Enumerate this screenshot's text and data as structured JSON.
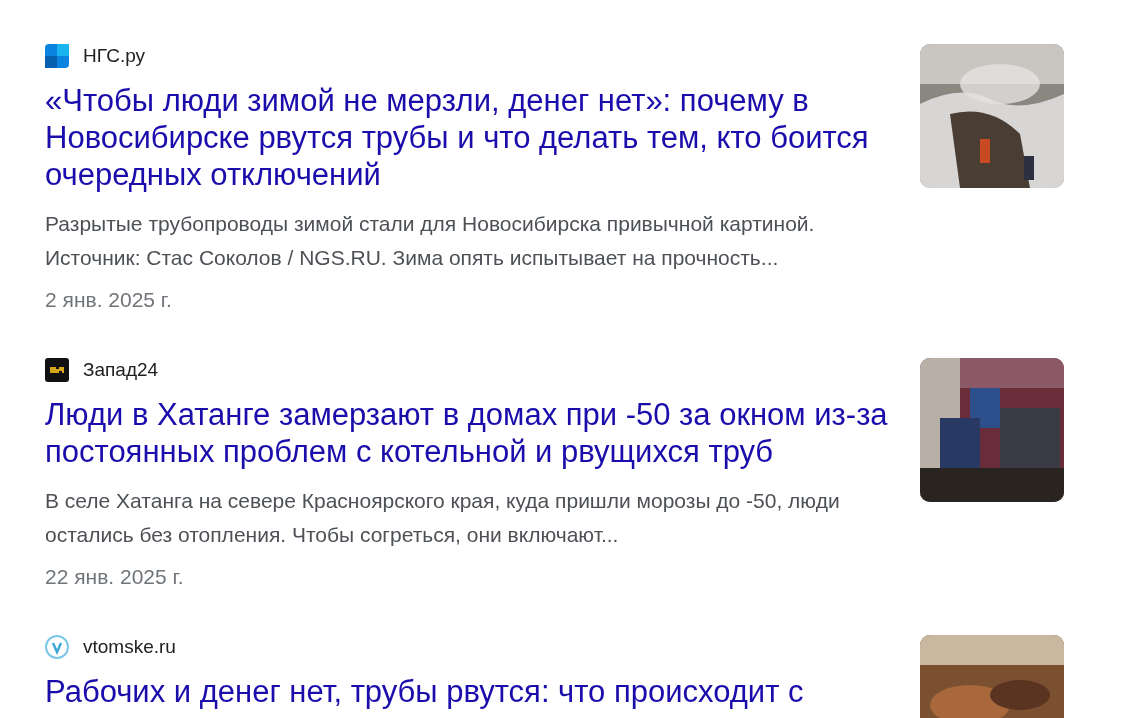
{
  "results": [
    {
      "source": "НГС.ру",
      "title": "«Чтобы люди зимой не мерзли, денег нет»: почему в Новосибирске рвутся трубы и что делать тем, кто боится очередных отключений",
      "snippet": "Разрытые трубопроводы зимой стали для Новосибирска привычной картиной. Источник: Стас Соколов / NGS.RU. Зима опять испытывает на прочность...",
      "date": "2 янв. 2025 г."
    },
    {
      "source": "Запад24",
      "title": "Люди в Хатанге замерзают в домах при -50 за окном из-за постоянных проблем с котельной и рвущихся труб",
      "snippet": "В селе Хатанга на севере Красноярского края, куда пришли морозы до -50, люди остались без отопления. Чтобы согреться, они включают...",
      "date": "22 янв. 2025 г."
    },
    {
      "source": "vtomske.ru",
      "title": "Рабочих и денег нет, трубы рвутся: что происходит с"
    }
  ]
}
